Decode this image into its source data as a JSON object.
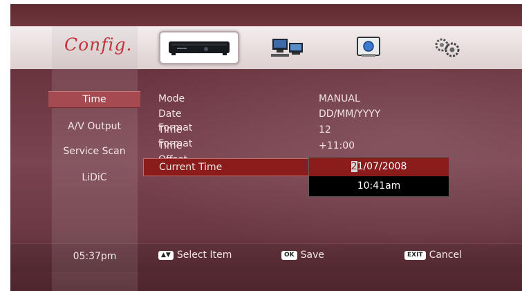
{
  "header": {
    "title": "Config.",
    "categories": [
      {
        "icon": "set-top-box-icon",
        "selected": true
      },
      {
        "icon": "network-computers-icon",
        "selected": false
      },
      {
        "icon": "certificate-screen-icon",
        "selected": false
      },
      {
        "icon": "gears-icon",
        "selected": false
      }
    ]
  },
  "sidebar": {
    "items": [
      {
        "label": "Time",
        "selected": true
      },
      {
        "label": "A/V Output",
        "selected": false
      },
      {
        "label": "Service Scan",
        "selected": false
      },
      {
        "label": "LiDiC",
        "selected": false
      }
    ]
  },
  "settings": [
    {
      "label": "Mode",
      "value": "MANUAL"
    },
    {
      "label": "Date Format",
      "value": "DD/MM/YYYY"
    },
    {
      "label": "Time Format",
      "value": "12"
    },
    {
      "label": "Time Offset",
      "value": "+11:00"
    },
    {
      "label": "Current Time",
      "value": ""
    }
  ],
  "popup": {
    "date_cursor": "2",
    "date_rest": "1/07/2008",
    "time": "10:41am"
  },
  "footer": {
    "clock": "05:37pm",
    "hints": [
      {
        "key": "▲▼",
        "label": "Select Item"
      },
      {
        "key": "OK",
        "label": "Save"
      },
      {
        "key": "EXIT",
        "label": "Cancel"
      }
    ]
  }
}
